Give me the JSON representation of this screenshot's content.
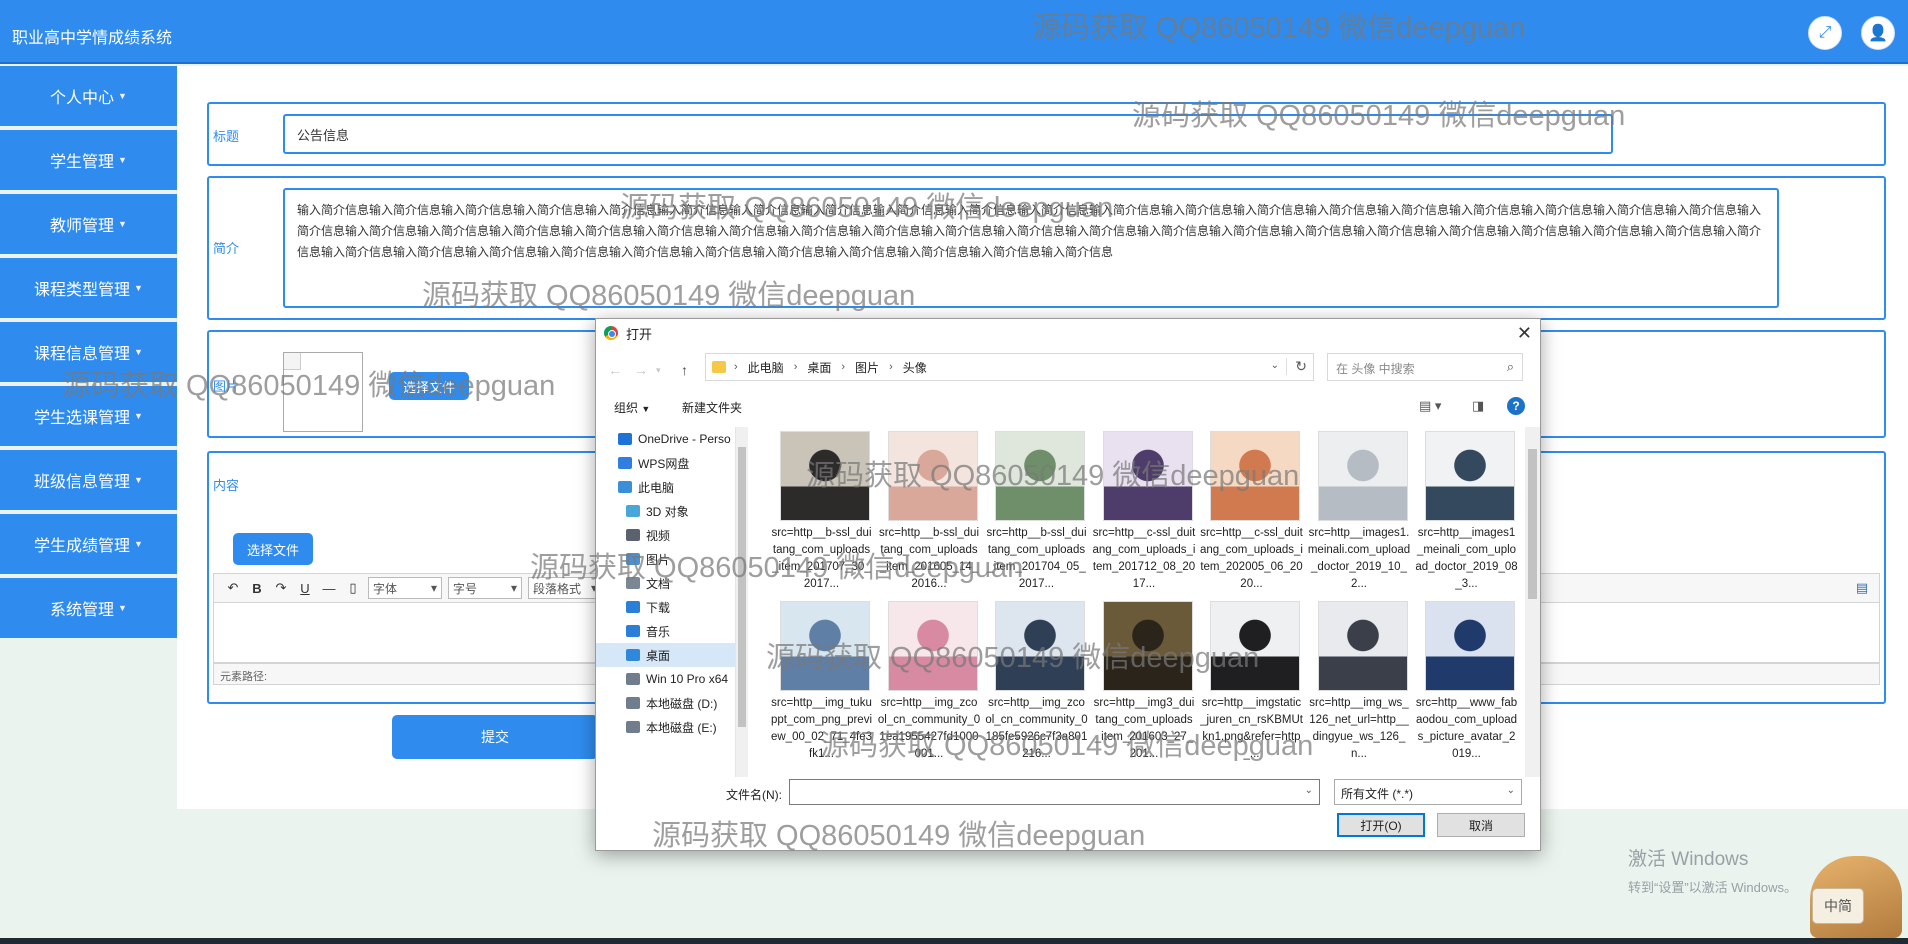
{
  "app": {
    "title": "职业高中学情成绩系统",
    "fullscreen_icon": "expand-icon",
    "user_icon": "user-icon"
  },
  "sidebar": {
    "items": [
      {
        "label": "个人中心"
      },
      {
        "label": "学生管理"
      },
      {
        "label": "教师管理"
      },
      {
        "label": "课程类型管理"
      },
      {
        "label": "课程信息管理"
      },
      {
        "label": "学生选课管理"
      },
      {
        "label": "班级信息管理"
      },
      {
        "label": "学生成绩管理"
      },
      {
        "label": "系统管理"
      }
    ]
  },
  "form": {
    "title_label": "标题",
    "title_value": "公告信息",
    "intro_label": "简介",
    "intro_value": "输入简介信息输入简介信息输入简介信息输入简介信息输入简介信息输入简介信息输入简介信息输入简介信息输入简介信息输入简介信息输入简介信息输入简介信息输入简介信息输入简介信息输入简介信息输入简介信息输入简介信息输入简介信息输入简介信息输入简介信息输入简介信息输入简介信息输入简介信息输入简介信息输入简介信息输入简介信息输入简介信息输入简介信息输入简介信息输入简介信息输入简介信息输入简介信息输入简介信息输入简介信息输入简介信息输入简介信息输入简介信息输入简介信息输入简介信息输入简介信息输入简介信息输入简介信息输入简介信息输入简介信息输入简介信息输入简介信息输入简介信息输入简介信息输入简介信息输入简介信息输入简介信息输入简介信息",
    "image_label": "图片",
    "upload_button": "选择文件",
    "content_label": "内容",
    "content_upload_button": "选择文件",
    "editor": {
      "font_select": "字体",
      "size_select": "字号",
      "format_select": "段落格式",
      "path_label": "元素路径:"
    },
    "submit_button": "提交"
  },
  "dialog": {
    "title": "打开",
    "breadcrumb": [
      "此电脑",
      "桌面",
      "图片",
      "头像"
    ],
    "search_placeholder": "在 头像 中搜索",
    "organize_label": "组织",
    "new_folder_label": "新建文件夹",
    "tree": [
      {
        "label": "OneDrive - Perso",
        "icon": "cloud-icon",
        "color": "#1e74d6"
      },
      {
        "label": "WPS网盘",
        "icon": "cloud-icon",
        "color": "#2f7ee0"
      },
      {
        "label": "此电脑",
        "icon": "computer-icon",
        "color": "#3b8fd9"
      },
      {
        "label": "3D 对象",
        "icon": "cube-icon",
        "color": "#49a6d8"
      },
      {
        "label": "视频",
        "icon": "video-icon",
        "color": "#5a6270"
      },
      {
        "label": "图片",
        "icon": "pictures-icon",
        "color": "#4b91d2"
      },
      {
        "label": "文档",
        "icon": "document-icon",
        "color": "#7a8795"
      },
      {
        "label": "下载",
        "icon": "download-icon",
        "color": "#2c7fd6"
      },
      {
        "label": "音乐",
        "icon": "music-icon",
        "color": "#2c7fd6"
      },
      {
        "label": "桌面",
        "icon": "desktop-icon",
        "color": "#2f88d9"
      },
      {
        "label": "Win 10 Pro x64",
        "icon": "drive-icon",
        "color": "#6f7d8c"
      },
      {
        "label": "本地磁盘 (D:)",
        "icon": "drive-icon",
        "color": "#6f7d8c"
      },
      {
        "label": "本地磁盘 (E:)",
        "icon": "drive-icon",
        "color": "#6f7d8c"
      }
    ],
    "files": [
      {
        "name": "src=http__b-ssl_duitang_com_uploads_item_201707_30_2017...",
        "colors": [
          "#c9c3b8",
          "#2d2a2a"
        ]
      },
      {
        "name": "src=http__b-ssl_duitang_com_uploads_item_201605_14_2016...",
        "colors": [
          "#f4e4de",
          "#d9a89a"
        ]
      },
      {
        "name": "src=http__b-ssl_duitang_com_uploads_item_201704_05_2017...",
        "colors": [
          "#dfe6dc",
          "#6f8f6a"
        ]
      },
      {
        "name": "src=http__c-ssl_duitang_com_uploads_item_201712_08_2017...",
        "colors": [
          "#e9e1f0",
          "#4e3d6a"
        ]
      },
      {
        "name": "src=http__c-ssl_duitang_com_uploads_item_202005_06_2020...",
        "colors": [
          "#f6d9c3",
          "#d17a4f"
        ]
      },
      {
        "name": "src=http__images1.meinali.com_upload_doctor_2019_10_2...",
        "colors": [
          "#eceef0",
          "#b6bcc4"
        ]
      },
      {
        "name": "src=http__images1_meinali_com_upload_doctor_2019_08_3...",
        "colors": [
          "#f1f2f3",
          "#34495e"
        ]
      },
      {
        "name": "src=http__img_tukuppt_com_png_preview_00_02_71_4fe3fk1...",
        "colors": [
          "#d8e6ef",
          "#5f7fa6"
        ]
      },
      {
        "name": "src=http__img_zcool_cn_community_01ea1955427fd1000001...",
        "colors": [
          "#f7e6ea",
          "#d78aa2"
        ]
      },
      {
        "name": "src=http__img_zcool_cn_community_0185fe5926c7f3a801216...",
        "colors": [
          "#dde6ef",
          "#2e3f56"
        ]
      },
      {
        "name": "src=http__img3_duitang_com_uploads_item_201603_27_201...",
        "colors": [
          "#6a5a3a",
          "#2b241a"
        ]
      },
      {
        "name": "src=http__imgstatic_juren_cn_rsKBMUtkn1.png&refer=http_...",
        "colors": [
          "#eef0f2",
          "#1f1f22"
        ]
      },
      {
        "name": "src=http__img_ws_126_net_url=http__dingyue_ws_126_n...",
        "colors": [
          "#e8eaee",
          "#3a3f4a"
        ]
      },
      {
        "name": "src=http__www_fabaodou_com_uploads_picture_avatar_2019...",
        "colors": [
          "#d9e2ee",
          "#1f3a6b"
        ]
      }
    ],
    "filename_label": "文件名(N):",
    "filename_value": "",
    "filetype_value": "所有文件 (*.*)",
    "open_button": "打开(O)",
    "cancel_button": "取消"
  },
  "watermark_text": "源码获取 QQ86050149 微信deepguan",
  "windows_activation": {
    "line1": "激活 Windows",
    "line2": "转到“设置”以激活 Windows。"
  },
  "mascot_label": "中简"
}
